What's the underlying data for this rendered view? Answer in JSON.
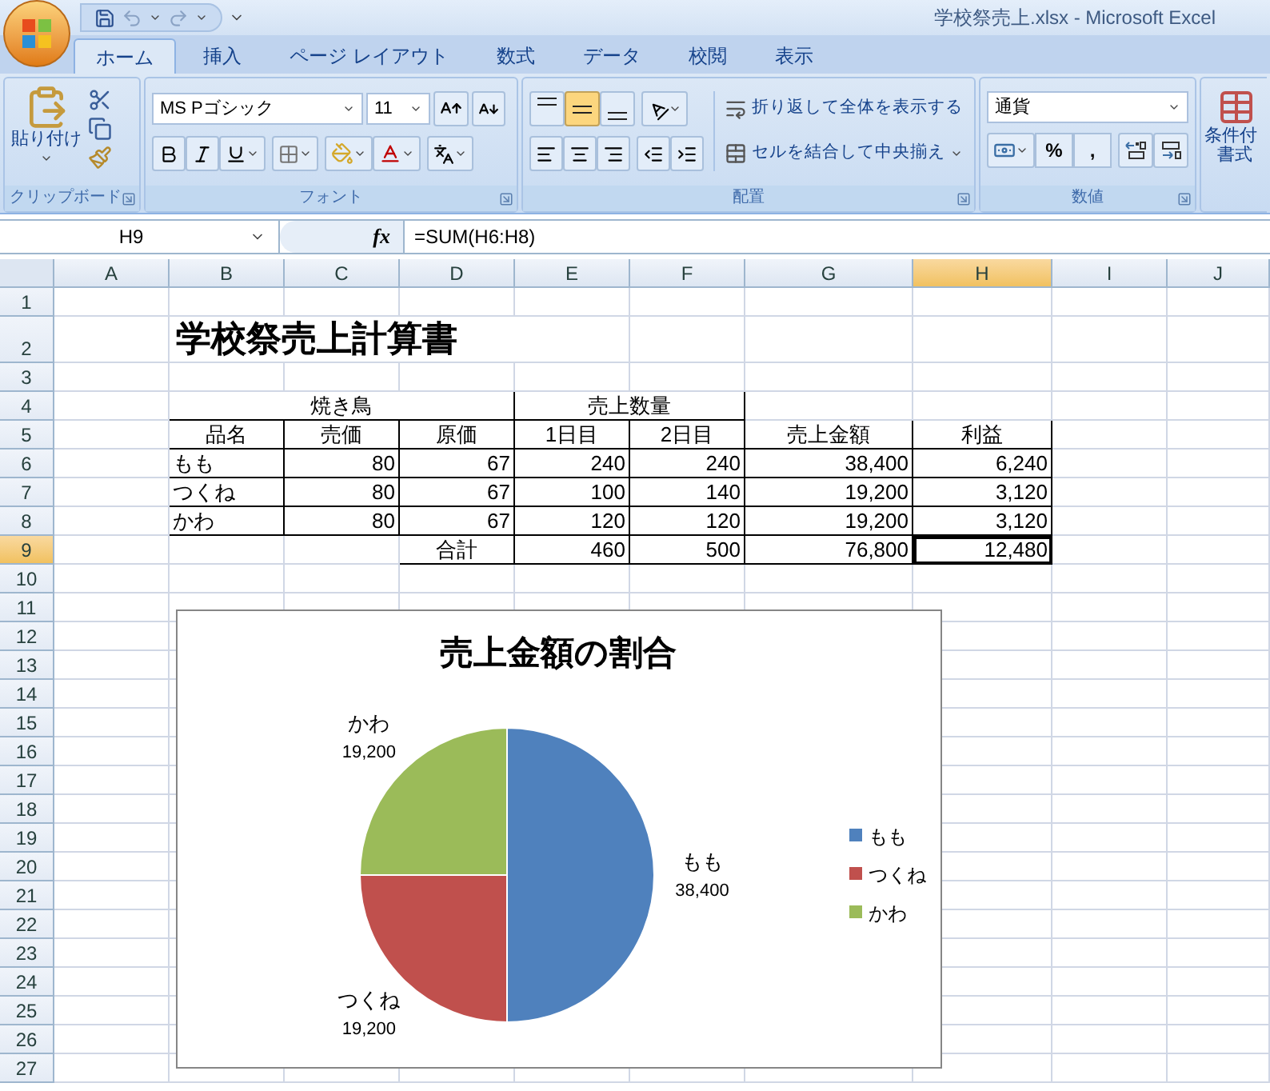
{
  "window": {
    "title": "学校祭売上.xlsx - Microsoft Excel"
  },
  "tabs": [
    {
      "label": "ホーム",
      "selected": true
    },
    {
      "label": "挿入",
      "selected": false
    },
    {
      "label": "ページ レイアウト",
      "selected": false
    },
    {
      "label": "数式",
      "selected": false
    },
    {
      "label": "データ",
      "selected": false
    },
    {
      "label": "校閲",
      "selected": false
    },
    {
      "label": "表示",
      "selected": false
    }
  ],
  "ribbon": {
    "clipboard": {
      "paste_label": "貼り付け",
      "group_label": "クリップボード"
    },
    "font": {
      "font_name": "MS Pゴシック",
      "font_size": "11",
      "group_label": "フォント"
    },
    "alignment": {
      "vertical_align": [
        {
          "selected": false
        },
        {
          "selected": true
        },
        {
          "selected": false
        }
      ],
      "wrap_text": "折り返して全体を表示する",
      "merge_center": "セルを結合して中央揃え",
      "group_label": "配置"
    },
    "number": {
      "format": "通貨",
      "buttons": [
        "%",
        ","
      ],
      "group_label": "数値"
    },
    "styles": {
      "conditional_format": [
        "条件付",
        "書式"
      ]
    }
  },
  "formula_bar": {
    "name_box": "H9",
    "function_label": "fx",
    "formula": "=SUM(H6:H8)"
  },
  "sheet": {
    "columns": [
      {
        "label": "A",
        "selected": false
      },
      {
        "label": "B",
        "selected": false
      },
      {
        "label": "C",
        "selected": false
      },
      {
        "label": "D",
        "selected": false
      },
      {
        "label": "E",
        "selected": false
      },
      {
        "label": "F",
        "selected": false
      },
      {
        "label": "G",
        "selected": false
      },
      {
        "label": "H",
        "selected": true
      },
      {
        "label": "I",
        "selected": false
      },
      {
        "label": "J",
        "selected": false
      }
    ],
    "rows": [
      {
        "label": "1",
        "selected": false
      },
      {
        "label": "2",
        "selected": false
      },
      {
        "label": "3",
        "selected": false
      },
      {
        "label": "4",
        "selected": false
      },
      {
        "label": "5",
        "selected": false
      },
      {
        "label": "6",
        "selected": false
      },
      {
        "label": "7",
        "selected": false
      },
      {
        "label": "8",
        "selected": false
      },
      {
        "label": "9",
        "selected": true
      },
      {
        "label": "10",
        "selected": false
      },
      {
        "label": "11",
        "selected": false
      },
      {
        "label": "12",
        "selected": false
      },
      {
        "label": "13",
        "selected": false
      },
      {
        "label": "14",
        "selected": false
      },
      {
        "label": "15",
        "selected": false
      },
      {
        "label": "16",
        "selected": false
      },
      {
        "label": "17",
        "selected": false
      },
      {
        "label": "18",
        "selected": false
      },
      {
        "label": "19",
        "selected": false
      },
      {
        "label": "20",
        "selected": false
      },
      {
        "label": "21",
        "selected": false
      },
      {
        "label": "22",
        "selected": false
      },
      {
        "label": "23",
        "selected": false
      },
      {
        "label": "24",
        "selected": false
      },
      {
        "label": "25",
        "selected": false
      },
      {
        "label": "26",
        "selected": false
      },
      {
        "label": "27",
        "selected": false
      }
    ],
    "title": "学校祭売上計算書",
    "table": {
      "group_headers": [
        "焼き鳥",
        "売上数量"
      ],
      "headers": [
        "品名",
        "売価",
        "原価",
        "1日目",
        "2日目",
        "売上金額",
        "利益"
      ],
      "rows": [
        [
          "もも",
          "80",
          "67",
          "240",
          "240",
          "38,400",
          "6,240"
        ],
        [
          "つくね",
          "80",
          "67",
          "100",
          "140",
          "19,200",
          "3,120"
        ],
        [
          "かわ",
          "80",
          "67",
          "120",
          "120",
          "19,200",
          "3,120"
        ]
      ],
      "total": {
        "label": "合計",
        "cells": [
          {
            "value": "460",
            "selected": false
          },
          {
            "value": "500",
            "selected": false
          },
          {
            "value": "76,800",
            "selected": false
          },
          {
            "value": "12,480",
            "selected": true
          }
        ]
      }
    },
    "chart": {
      "chart_data": {
        "type": "pie",
        "title": "売上金額の割合",
        "categories": [
          "もも",
          "つくね",
          "かわ"
        ],
        "values": [
          38400,
          19200,
          19200
        ],
        "value_labels": [
          "38,400",
          "19,200",
          "19,200"
        ]
      },
      "legend": [
        {
          "label": "もも",
          "color": "#4f81bd"
        },
        {
          "label": "つくね",
          "color": "#c0504d"
        },
        {
          "label": "かわ",
          "color": "#9bbb59"
        }
      ]
    }
  }
}
